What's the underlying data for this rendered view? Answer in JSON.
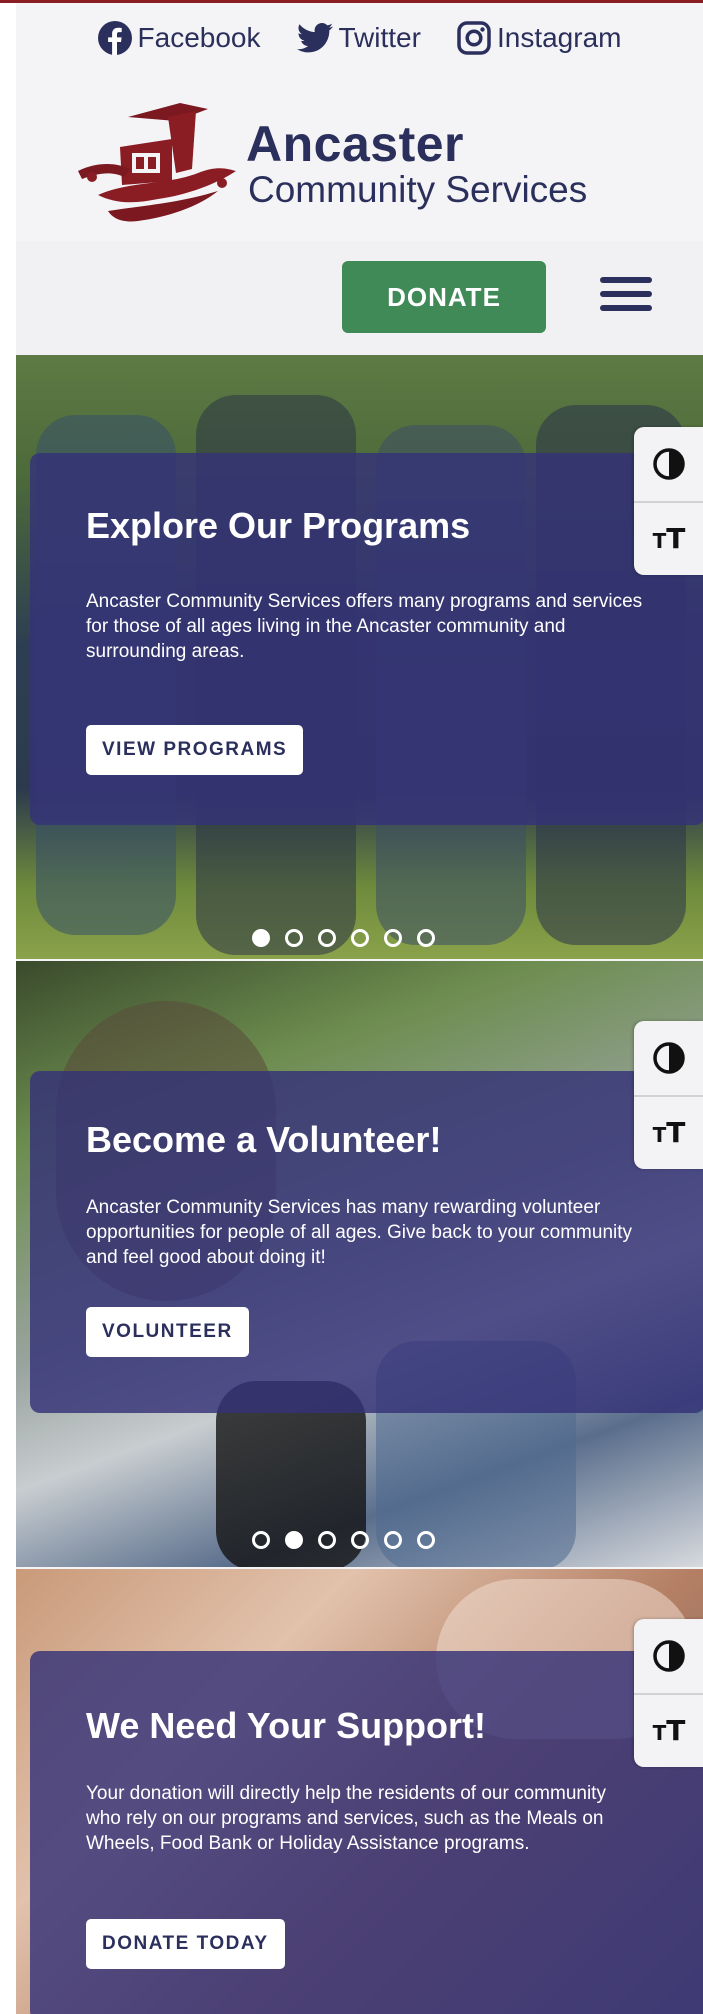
{
  "social": {
    "facebook": {
      "label": "Facebook",
      "icon": "facebook-icon"
    },
    "twitter": {
      "label": "Twitter",
      "icon": "twitter-icon"
    },
    "instagram": {
      "label": "Instagram",
      "icon": "instagram-icon"
    }
  },
  "logo": {
    "line1": "Ancaster",
    "line2": "Community Services"
  },
  "nav": {
    "donate_label": "DONATE",
    "menu_icon": "hamburger-menu-icon"
  },
  "accessibility": {
    "contrast_icon": "contrast-icon",
    "text_size_icon": "text-size-icon"
  },
  "slides": [
    {
      "title": "Explore Our Programs",
      "text": "Ancaster Community Services offers many programs and services for those of all ages living in the Ancaster community and surrounding areas.",
      "button": "VIEW PROGRAMS",
      "active_dot": 1
    },
    {
      "title": "Become a Volunteer!",
      "text": "Ancaster Community Services has many rewarding volunteer opportunities for people of all ages. Give back to your community and feel good about doing it!",
      "button": "VOLUNTEER",
      "active_dot": 2
    },
    {
      "title": "We Need Your Support!",
      "text": "Your donation will directly help the residents of our community who rely on our programs and services, such as the Meals on Wheels, Food Bank or Holiday Assistance programs.",
      "button": "DONATE TODAY"
    }
  ],
  "colors": {
    "brand_navy": "#2b2f5c",
    "brand_maroon": "#8a1c24",
    "donate_green": "#3f8a57",
    "panel_purple": "#34327a"
  }
}
